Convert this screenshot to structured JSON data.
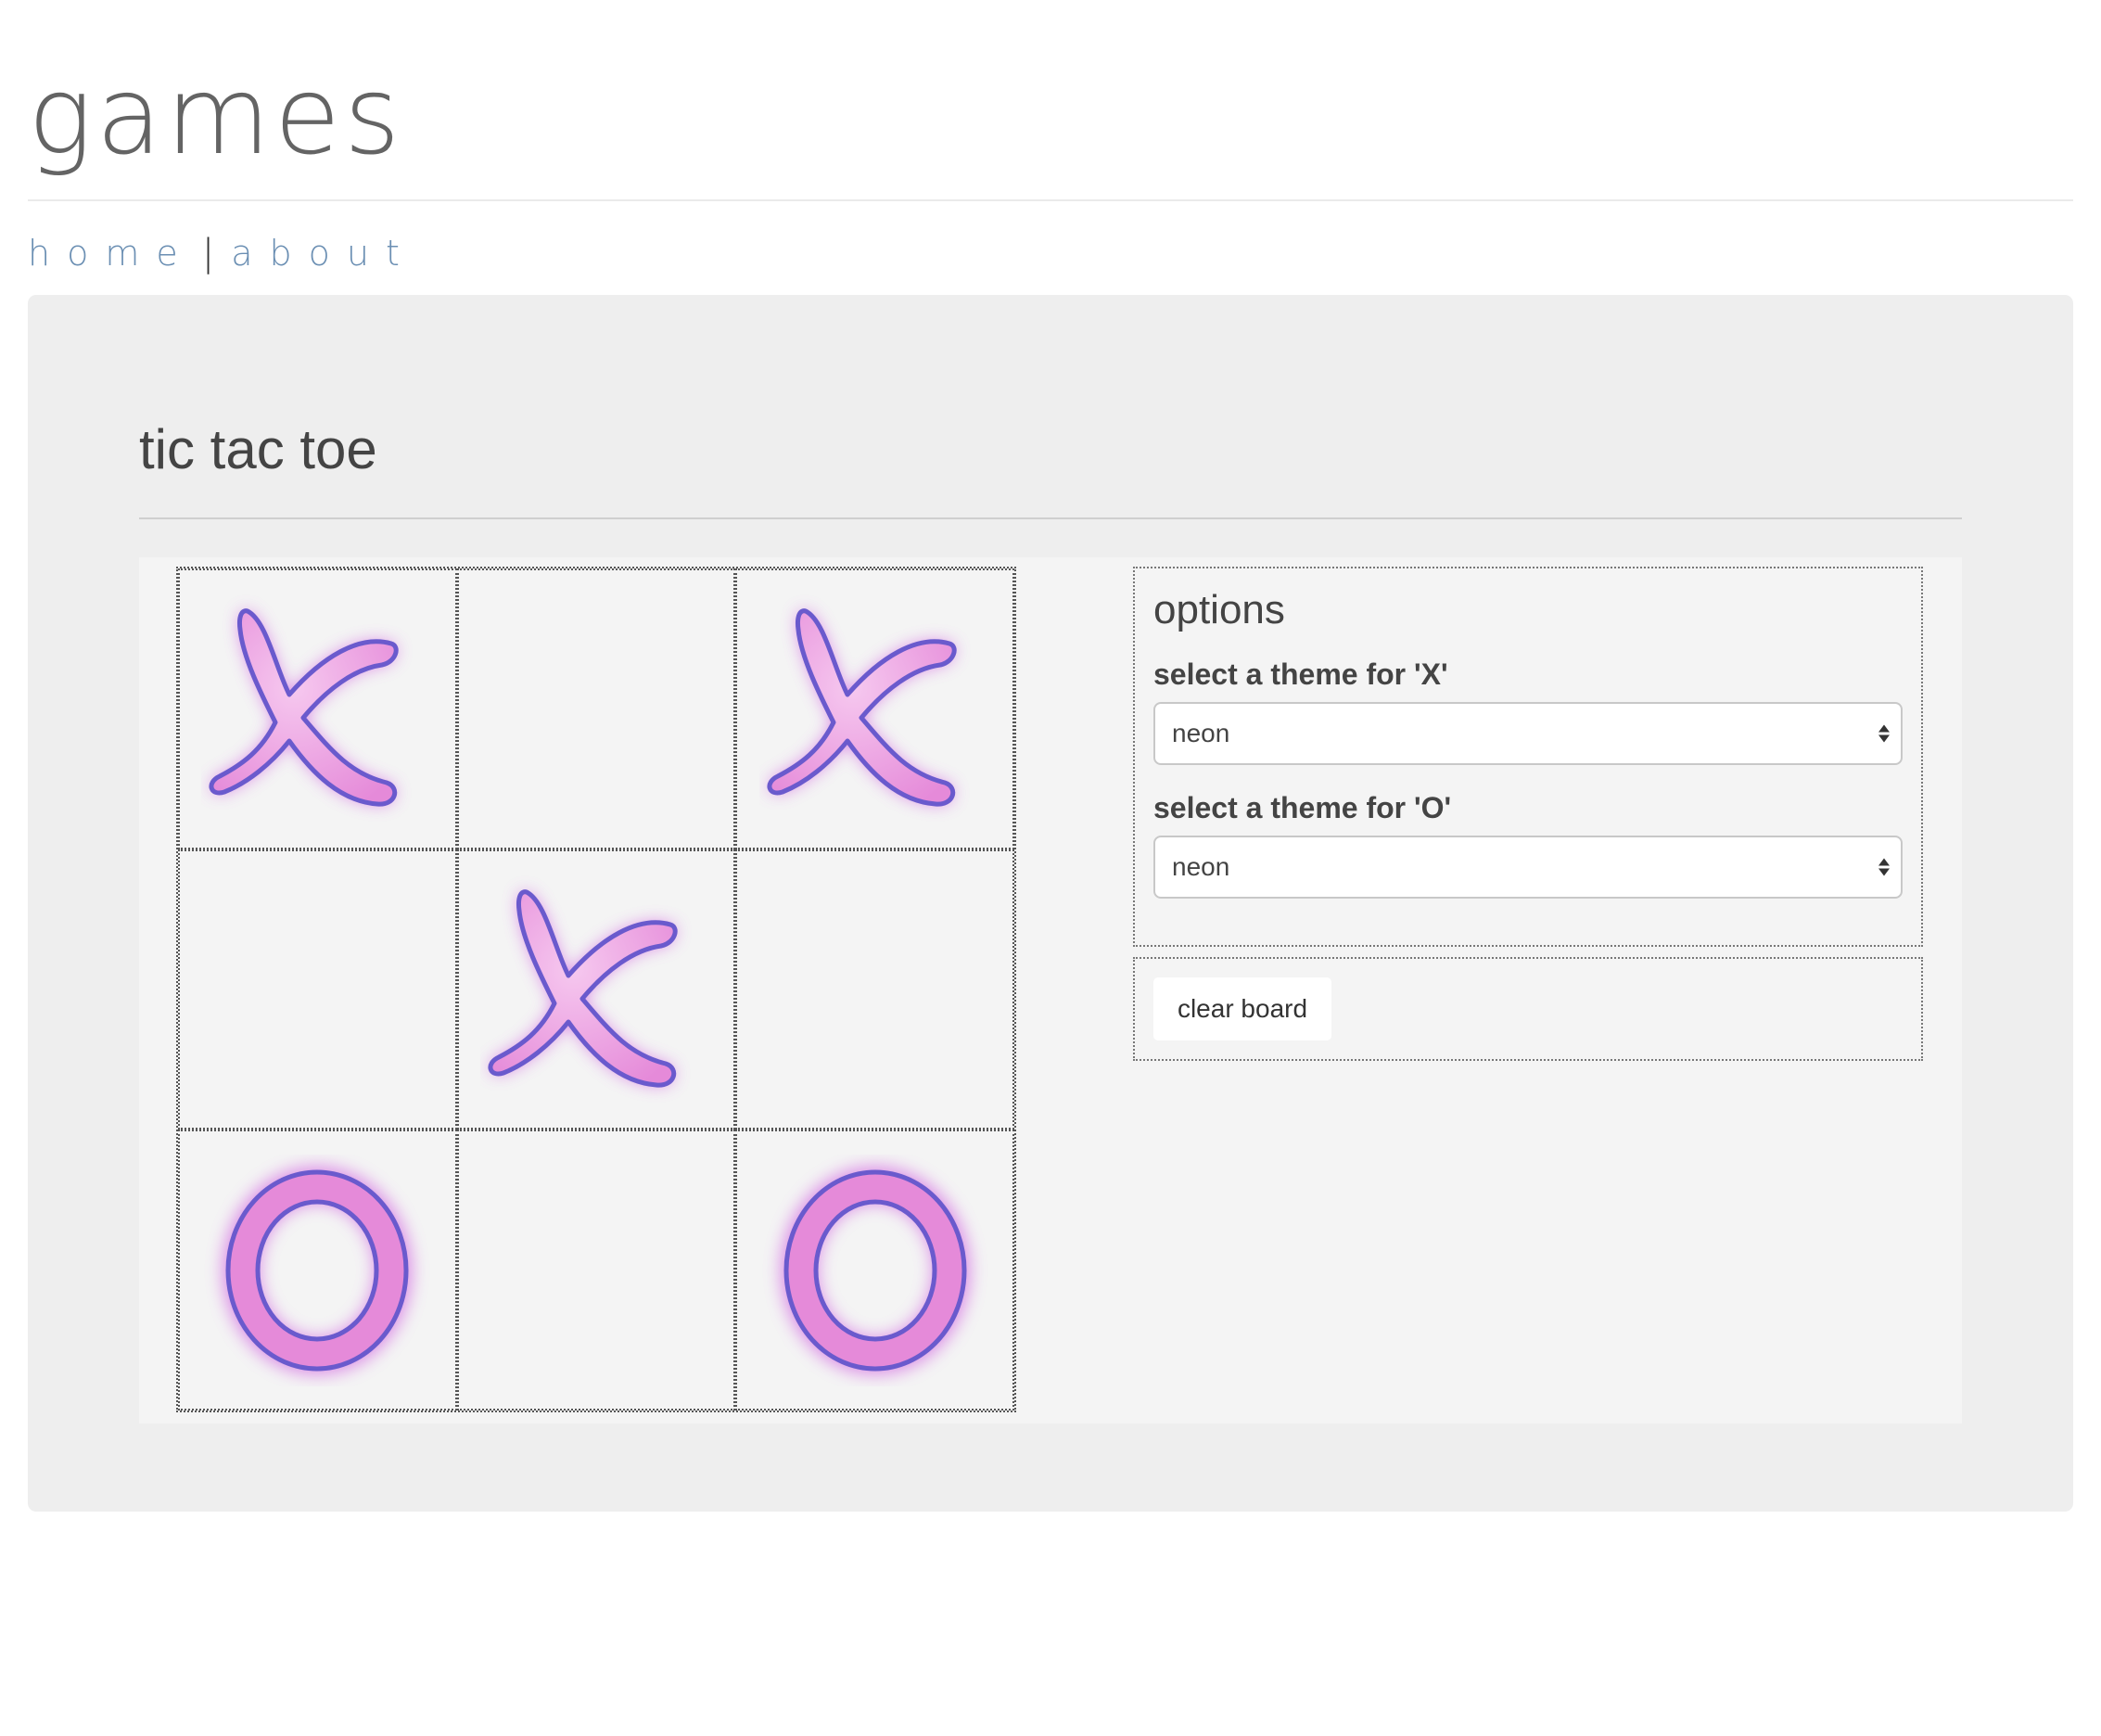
{
  "site": {
    "title": "games",
    "nav": {
      "home_label": "home",
      "separator": "|",
      "about_label": "about"
    }
  },
  "game": {
    "title": "tic tac toe",
    "board": [
      [
        "X",
        "",
        "X"
      ],
      [
        "",
        "X",
        ""
      ],
      [
        "O",
        "",
        "O"
      ]
    ],
    "mark_theme_colors": {
      "fill": "#e58ad9",
      "outline": "#6a5acd",
      "glow": "#d060e0"
    }
  },
  "options": {
    "title": "options",
    "x_theme_label": "select a theme for 'X'",
    "x_theme_value": "neon",
    "o_theme_label": "select a theme for 'O'",
    "o_theme_value": "neon"
  },
  "actions": {
    "clear_label": "clear board"
  }
}
